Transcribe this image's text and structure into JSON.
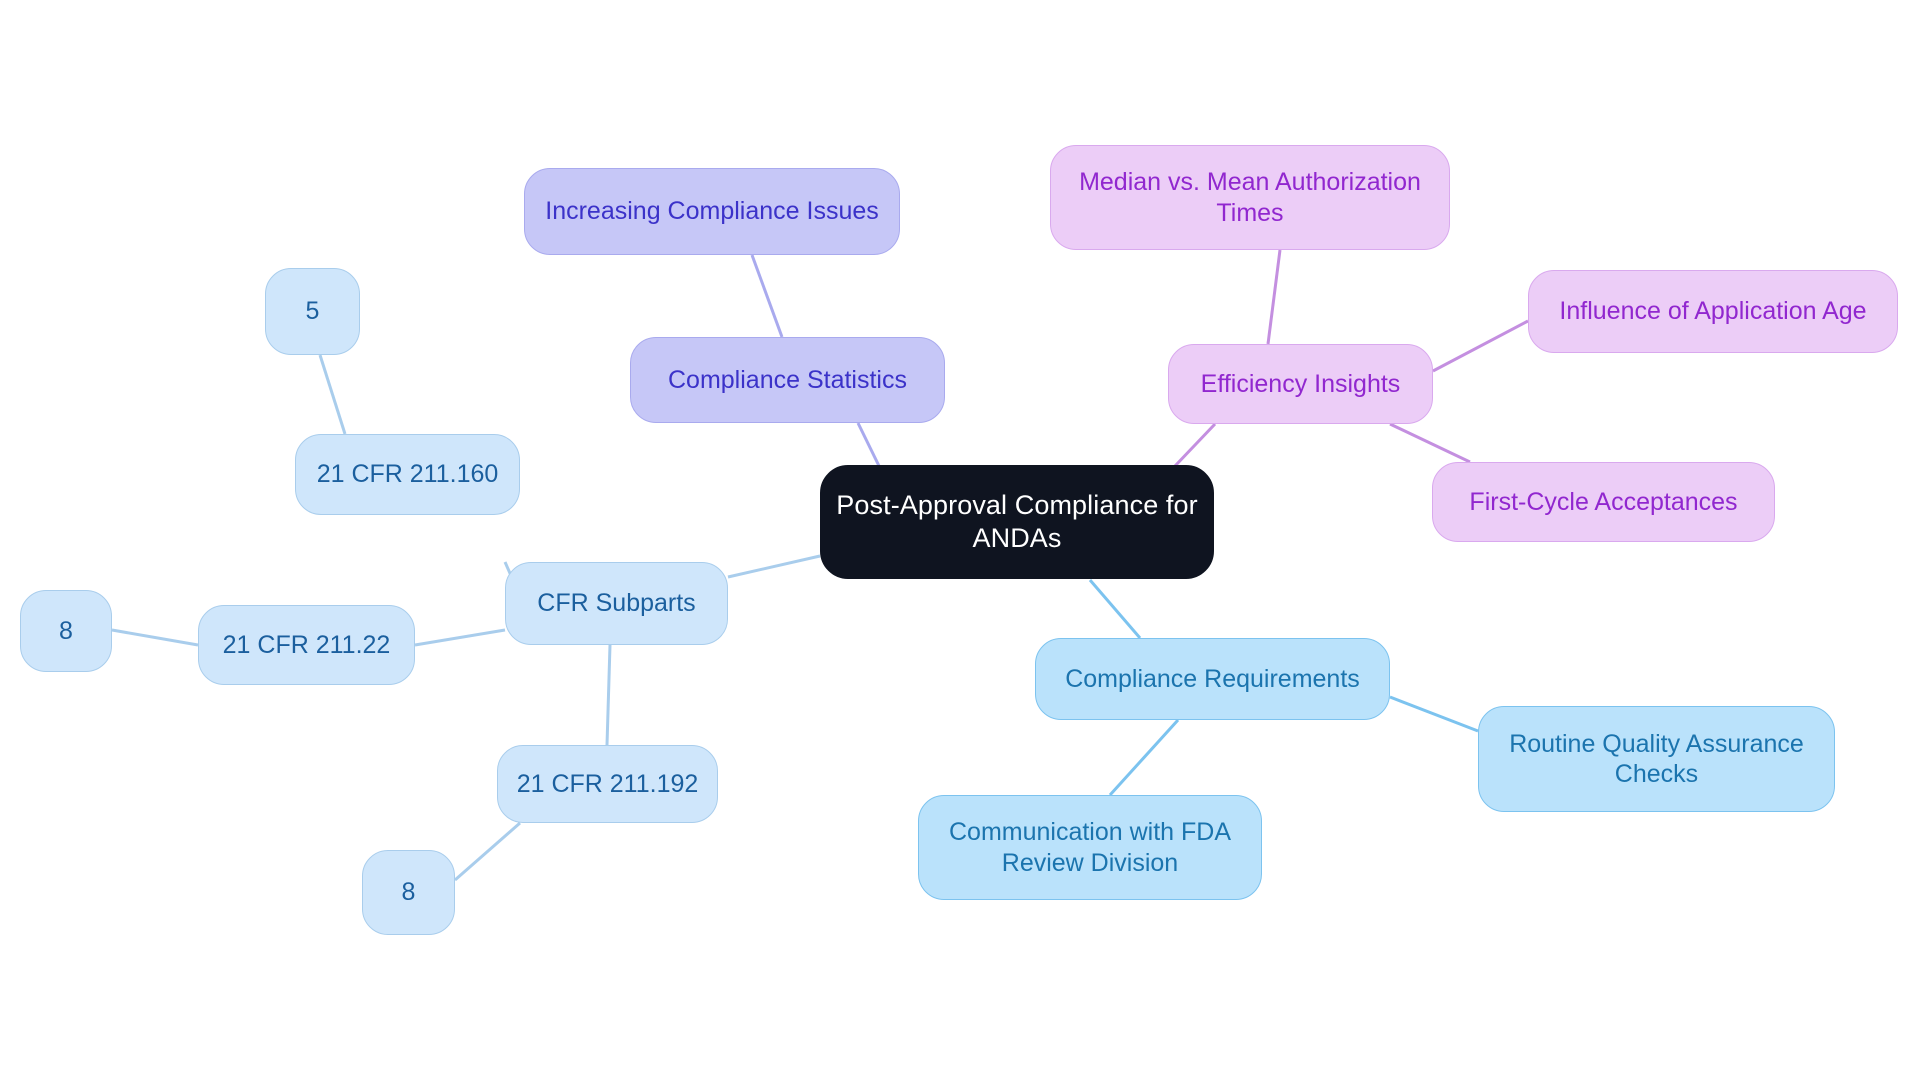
{
  "diagram": {
    "type": "mind-map",
    "title": "Post-Approval Compliance for ANDAs",
    "background": "#ffffff",
    "palette": {
      "root_fill": "#0f1420",
      "root_text": "#ffffff",
      "lavender_fill": "#c6c7f7",
      "lavender_border": "#a9aaee",
      "lavender_text": "#3b32c9",
      "violet_fill": "#eccdf7",
      "violet_border": "#d9a9ee",
      "violet_text": "#9127cf",
      "cyan_fill": "#bae2fb",
      "cyan_border": "#7cc3ef",
      "cyan_text": "#1b74ae",
      "skyblue_fill": "#cfe6fb",
      "skyblue_border": "#a9cdec",
      "skyblue_text": "#1b5f9e"
    },
    "nodes": {
      "root": {
        "label": "Post-Approval Compliance for\nANDAs"
      },
      "compliance_statistics": {
        "label": "Compliance Statistics"
      },
      "increasing_compliance_issues": {
        "label": "Increasing Compliance Issues"
      },
      "efficiency_insights": {
        "label": "Efficiency Insights"
      },
      "median_vs_mean": {
        "label": "Median vs. Mean Authorization\nTimes"
      },
      "influence_application_age": {
        "label": "Influence of Application Age"
      },
      "first_cycle_acceptances": {
        "label": "First-Cycle Acceptances"
      },
      "compliance_requirements": {
        "label": "Compliance Requirements"
      },
      "routine_qa_checks": {
        "label": "Routine Quality Assurance\nChecks"
      },
      "communication_fda": {
        "label": "Communication with FDA\nReview Division"
      },
      "cfr_subparts": {
        "label": "CFR Subparts"
      },
      "cfr_211_160": {
        "label": "21 CFR 211.160"
      },
      "cfr_211_160_count": {
        "label": "5"
      },
      "cfr_211_22": {
        "label": "21 CFR 211.22"
      },
      "cfr_211_22_count": {
        "label": "8"
      },
      "cfr_211_192": {
        "label": "21 CFR 211.192"
      },
      "cfr_211_192_count": {
        "label": "8"
      }
    },
    "edges": [
      {
        "from": "root",
        "to": "compliance_statistics"
      },
      {
        "from": "compliance_statistics",
        "to": "increasing_compliance_issues"
      },
      {
        "from": "root",
        "to": "efficiency_insights"
      },
      {
        "from": "efficiency_insights",
        "to": "median_vs_mean"
      },
      {
        "from": "efficiency_insights",
        "to": "influence_application_age"
      },
      {
        "from": "efficiency_insights",
        "to": "first_cycle_acceptances"
      },
      {
        "from": "root",
        "to": "compliance_requirements"
      },
      {
        "from": "compliance_requirements",
        "to": "routine_qa_checks"
      },
      {
        "from": "compliance_requirements",
        "to": "communication_fda"
      },
      {
        "from": "root",
        "to": "cfr_subparts"
      },
      {
        "from": "cfr_subparts",
        "to": "cfr_211_160"
      },
      {
        "from": "cfr_211_160",
        "to": "cfr_211_160_count"
      },
      {
        "from": "cfr_subparts",
        "to": "cfr_211_22"
      },
      {
        "from": "cfr_211_22",
        "to": "cfr_211_22_count"
      },
      {
        "from": "cfr_subparts",
        "to": "cfr_211_192"
      },
      {
        "from": "cfr_211_192",
        "to": "cfr_211_192_count"
      }
    ]
  }
}
